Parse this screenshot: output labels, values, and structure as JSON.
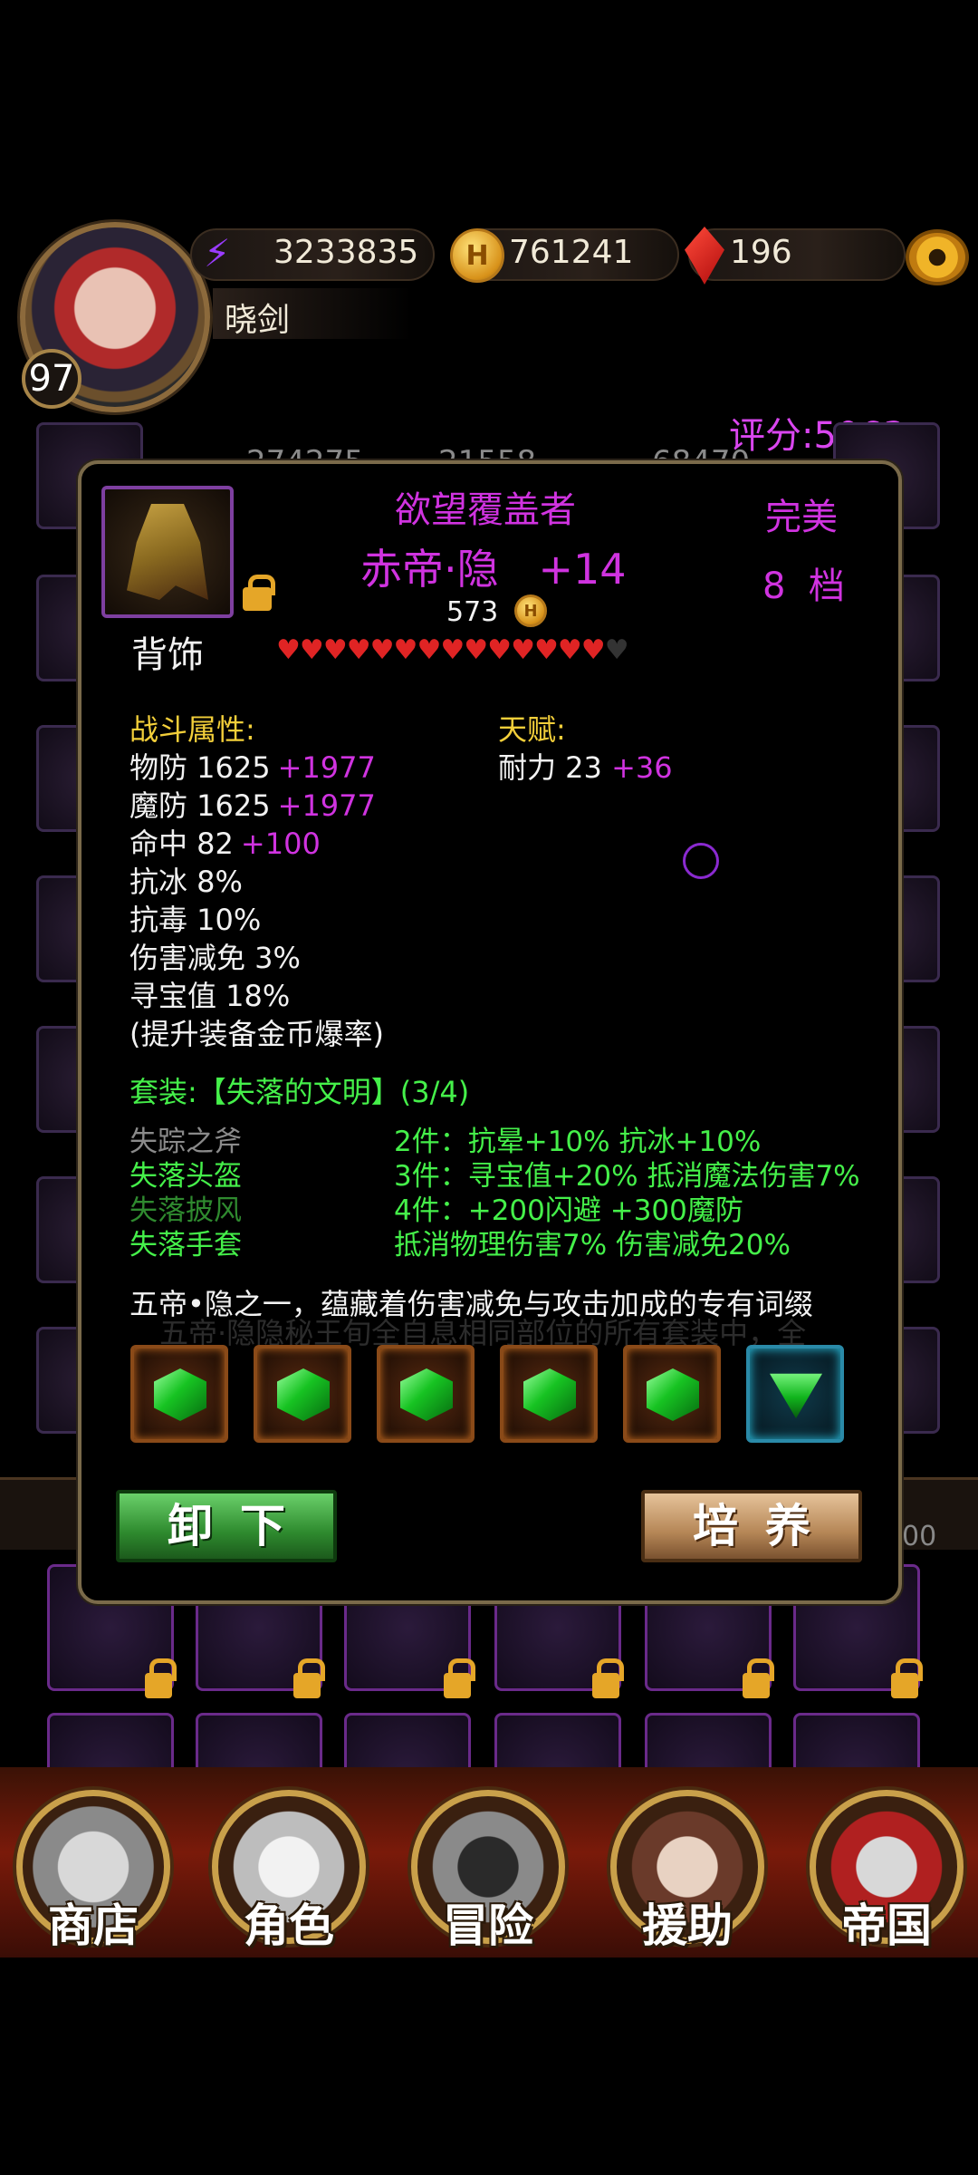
{
  "header": {
    "level": "97",
    "player_name": "晓剑",
    "power": "3233835",
    "gold": "761241",
    "gems": "196",
    "score": "评分:5063"
  },
  "background_stats": [
    "274275",
    "21558",
    "68470"
  ],
  "background_right_value": "00",
  "item": {
    "subtitle": "欲望覆盖者",
    "name": "赤帝·隐   +14",
    "quality": "完美",
    "grade": "8  档",
    "price": "573",
    "slot": "背饰",
    "stars_total": 15,
    "stars_filled": 14
  },
  "combat": {
    "title": "战斗属性:",
    "lines": [
      {
        "label": "物防 1625",
        "bonus": "+1977"
      },
      {
        "label": "魔防 1625",
        "bonus": "+1977"
      },
      {
        "label": "命中 82",
        "bonus": "+100"
      },
      {
        "label": "抗冰 8%",
        "bonus": ""
      },
      {
        "label": "抗毒 10%",
        "bonus": ""
      },
      {
        "label": "伤害减免 3%",
        "bonus": ""
      },
      {
        "label": "寻宝值 18%",
        "bonus": ""
      },
      {
        "label": "(提升装备金币爆率)",
        "bonus": ""
      }
    ]
  },
  "talent": {
    "title": "天赋:",
    "label": "耐力 23",
    "bonus": "+36"
  },
  "set": {
    "title": "套装:【失落的文明】(3/4)",
    "pieces": [
      "失踪之斧",
      "失落头盔",
      "失落披风",
      "失落手套"
    ],
    "bonuses": [
      "2件：抗晕+10% 抗冰+10%",
      "3件：寻宝值+20% 抵消魔法伤害7%",
      "4件：+200闪避 +300魔防",
      "抵消物理伤害7% 伤害减免20%"
    ]
  },
  "description": "五帝•隐之一，蕴藏着伤害减免与攻击加成的专有词缀",
  "description_faded": "五帝·隐隐秘王旬全自息相同部位的所有套装中，全",
  "buttons": {
    "unequip": "卸下",
    "cultivate": "培养"
  },
  "nav": [
    "商店",
    "角色",
    "冒险",
    "援助",
    "帝国"
  ]
}
